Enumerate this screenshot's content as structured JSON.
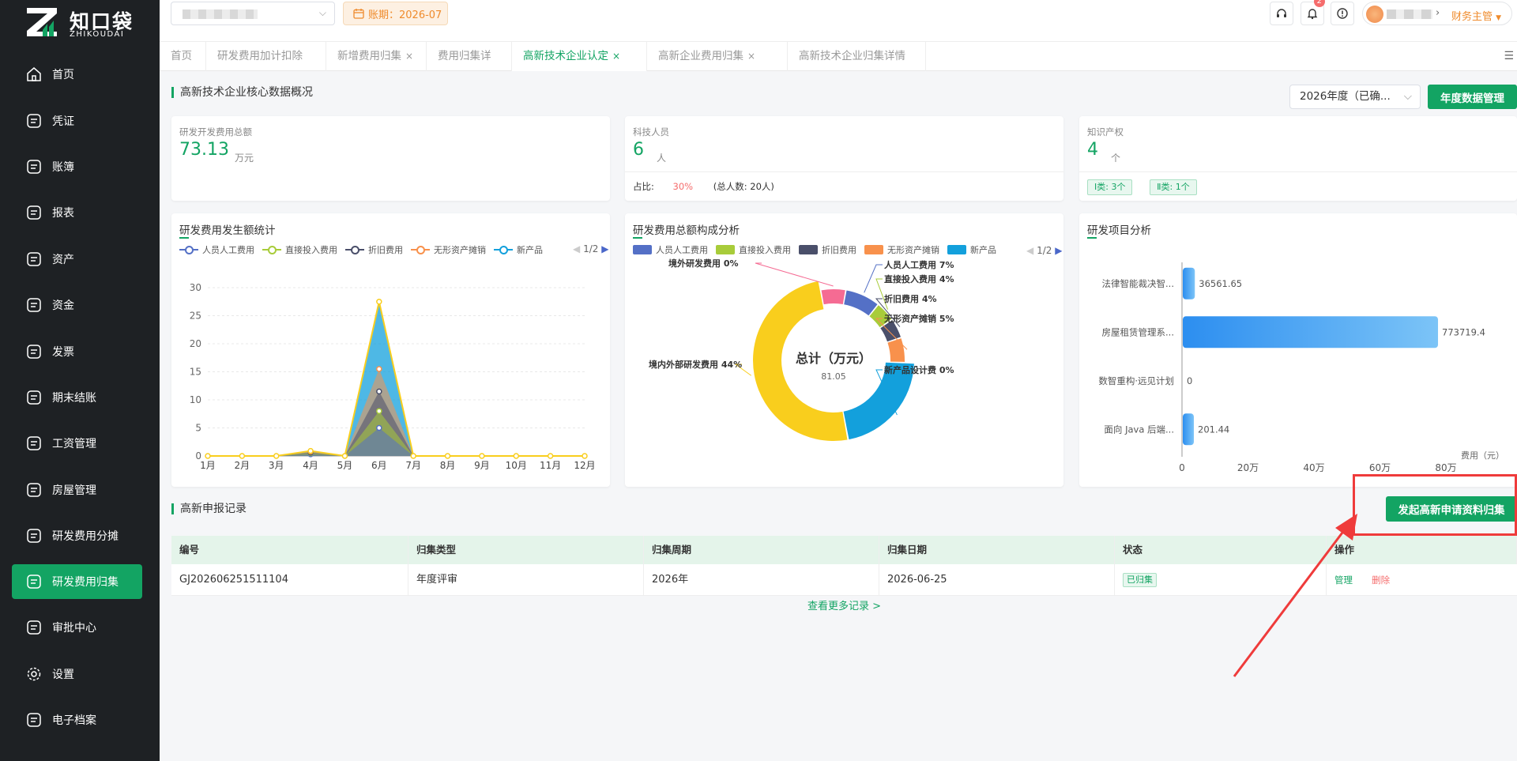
{
  "app": {
    "name": "知口袋",
    "sub": "ZHIKOUDAI"
  },
  "sidebar": {
    "items": [
      {
        "label": "首页",
        "icon": "home-icon"
      },
      {
        "label": "凭证",
        "icon": "voucher-icon"
      },
      {
        "label": "账簿",
        "icon": "book-icon"
      },
      {
        "label": "报表",
        "icon": "report-icon"
      },
      {
        "label": "资产",
        "icon": "asset-icon"
      },
      {
        "label": "资金",
        "icon": "fund-icon"
      },
      {
        "label": "发票",
        "icon": "invoice-icon"
      },
      {
        "label": "期末结账",
        "icon": "calendar-check-icon"
      },
      {
        "label": "工资管理",
        "icon": "salary-icon"
      },
      {
        "label": "房屋管理",
        "icon": "house-icon"
      },
      {
        "label": "研发费用分摊",
        "icon": "allocation-icon"
      },
      {
        "label": "研发费用归集",
        "icon": "collection-icon",
        "active": true
      },
      {
        "label": "审批中心",
        "icon": "approval-icon"
      },
      {
        "label": "设置",
        "icon": "gear-icon"
      },
      {
        "label": "电子档案",
        "icon": "archive-icon"
      }
    ]
  },
  "header": {
    "period_label": "账期：2026-07",
    "notify_count": "2",
    "role": "财务主管"
  },
  "tabs": [
    {
      "label": "首页"
    },
    {
      "label": "研发费用加计扣除",
      "closable": true
    },
    {
      "label": "新增费用归集",
      "closable": true
    },
    {
      "label": "费用归集详情",
      "closable": true
    },
    {
      "label": "高新技术企业认定",
      "closable": true,
      "active": true
    },
    {
      "label": "高新企业费用归集",
      "closable": true
    },
    {
      "label": "高新技术企业归集详情",
      "closable": true
    }
  ],
  "overview": {
    "title": "高新技术企业核心数据概况",
    "year_select": "2026年度（已确...",
    "year_btn": "年度数据管理"
  },
  "kpis": {
    "rd_total": {
      "label": "研发开发费用总额",
      "value": "73.13",
      "unit": "万元"
    },
    "staff": {
      "label": "科技人员",
      "value": "6",
      "unit": "人",
      "ratio_label": "占比:",
      "ratio": "30%",
      "total": "(总人数: 20人)"
    },
    "ip": {
      "label": "知识产权",
      "value": "4",
      "unit": "个",
      "tag1": "Ⅰ类: 3个",
      "tag2": "Ⅱ类: 1个"
    }
  },
  "colors": {
    "accent": "#13a463",
    "s1": "#5470c6",
    "s2": "#a8cc3a",
    "s3": "#4a4f6a",
    "s4": "#f8914c",
    "s5": "#13a0dc",
    "s6": "#f9ce1d",
    "s7": "#f56b93"
  },
  "chart_line": {
    "title": "研发费用发生额统计",
    "pager": "1/2",
    "legend": [
      "人员人工费用",
      "直接投入费用",
      "折旧费用",
      "无形资产摊销",
      "新产品"
    ],
    "chart_data": {
      "type": "area",
      "categories": [
        "1月",
        "2月",
        "3月",
        "4月",
        "5月",
        "6月",
        "7月",
        "8月",
        "9月",
        "10月",
        "11月",
        "12月"
      ],
      "ylim": [
        0,
        30
      ],
      "yticks": [
        "0",
        "5",
        "10",
        "15",
        "20",
        "25",
        "30"
      ],
      "series": [
        {
          "name": "人员人工费用",
          "values": [
            0,
            0,
            0,
            0.3,
            0,
            5,
            0,
            0,
            0,
            0,
            0,
            0
          ]
        },
        {
          "name": "直接投入费用",
          "values": [
            0,
            0,
            0,
            0.5,
            0,
            8,
            0,
            0,
            0,
            0,
            0,
            0
          ]
        },
        {
          "name": "折旧费用",
          "values": [
            0,
            0,
            0,
            0.6,
            0,
            11.5,
            0,
            0,
            0,
            0,
            0,
            0
          ]
        },
        {
          "name": "无形资产摊销",
          "values": [
            0,
            0,
            0,
            0.8,
            0,
            15.5,
            0,
            0,
            0,
            0,
            0,
            0
          ]
        },
        {
          "name": "新产品",
          "values": [
            0,
            0,
            0,
            0.9,
            0,
            27.5,
            0,
            0,
            0,
            0,
            0,
            0
          ]
        }
      ]
    }
  },
  "chart_pie": {
    "title": "研发费用总额构成分析",
    "pager": "1/2",
    "legend": [
      "人员人工费用",
      "直接投入费用",
      "折旧费用",
      "无形资产摊销",
      "新产品"
    ],
    "center_title": "总计（万元）",
    "center_value": "81.05",
    "chart_data": {
      "type": "pie",
      "slices": [
        {
          "label": "人员人工费用 7%",
          "value": 7
        },
        {
          "label": "直接投入费用 4%",
          "value": 4
        },
        {
          "label": "折旧费用 4%",
          "value": 4
        },
        {
          "label": "无形资产摊销 5%",
          "value": 5
        },
        {
          "label": "新产品设计费 0%",
          "value": 19
        },
        {
          "label": "境内外部研发费用 44%",
          "value": 44
        },
        {
          "label": "境外研发费用 0%",
          "value": 5
        }
      ]
    }
  },
  "chart_bar": {
    "title": "研发项目分析",
    "xlabel": "费用（元）",
    "chart_data": {
      "type": "bar",
      "orientation": "horizontal",
      "categories": [
        "法律智能裁决智...",
        "房屋租赁管理系...",
        "数智重构·远见计划",
        "面向 Java 后端..."
      ],
      "values": [
        36561.65,
        773719.4,
        0,
        201.44
      ],
      "value_labels": [
        "36561.65",
        "773719.4",
        "0",
        "201.44"
      ],
      "xlim": [
        0,
        800000
      ],
      "xticks": [
        "0",
        "20万",
        "40万",
        "60万",
        "80万"
      ]
    }
  },
  "records": {
    "title": "高新申报记录",
    "start_btn": "发起高新申请资料归集",
    "columns": [
      "编号",
      "归集类型",
      "归集周期",
      "归集日期",
      "状态",
      "操作"
    ],
    "rows": [
      {
        "id": "GJ202606251511104",
        "type": "年度评审",
        "period": "2026年",
        "date": "2026-06-25",
        "status": "已归集",
        "manage": "管理",
        "delete": "删除"
      }
    ],
    "more": "查看更多记录 >"
  }
}
